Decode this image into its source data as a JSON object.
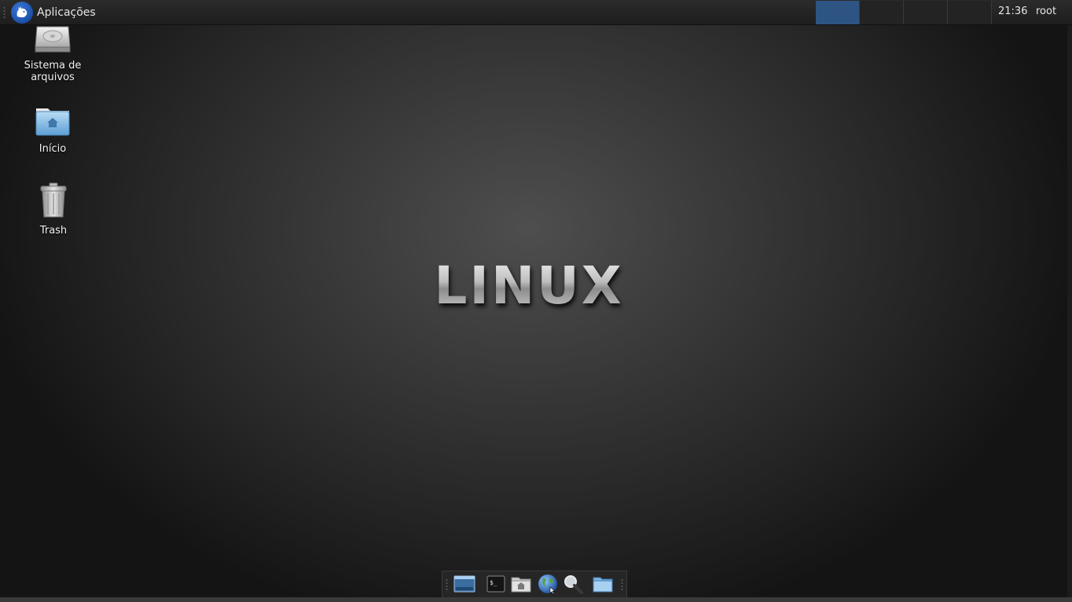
{
  "top_panel": {
    "apps_label": "Aplicações",
    "logo_icon": "xfce-mouse-icon",
    "workspaces": [
      {
        "name": "workspace-1",
        "active": true
      },
      {
        "name": "workspace-2",
        "active": false
      },
      {
        "name": "workspace-3",
        "active": false
      },
      {
        "name": "workspace-4",
        "active": false
      }
    ],
    "clock": "21:36",
    "user": "root"
  },
  "desktop": {
    "icons": [
      {
        "label": "Sistema de arquivos",
        "icon": "hard-drive-icon"
      },
      {
        "label": "Início",
        "icon": "home-folder-icon"
      },
      {
        "label": "Trash",
        "icon": "trash-icon"
      }
    ],
    "wallpaper_logo": "LINUX"
  },
  "dock": {
    "items": [
      {
        "name": "show-desktop",
        "icon": "show-desktop-icon"
      },
      {
        "name": "terminal",
        "icon": "terminal-icon"
      },
      {
        "name": "home-folder",
        "icon": "home-folder-icon"
      },
      {
        "name": "web-browser",
        "icon": "globe-icon"
      },
      {
        "name": "app-finder",
        "icon": "search-icon"
      },
      {
        "name": "file-manager",
        "icon": "folder-icon"
      }
    ]
  },
  "colors": {
    "panel_bg": "#222222",
    "active_workspace": "#2e5484",
    "xfce_blue": "#1a4fa8"
  }
}
